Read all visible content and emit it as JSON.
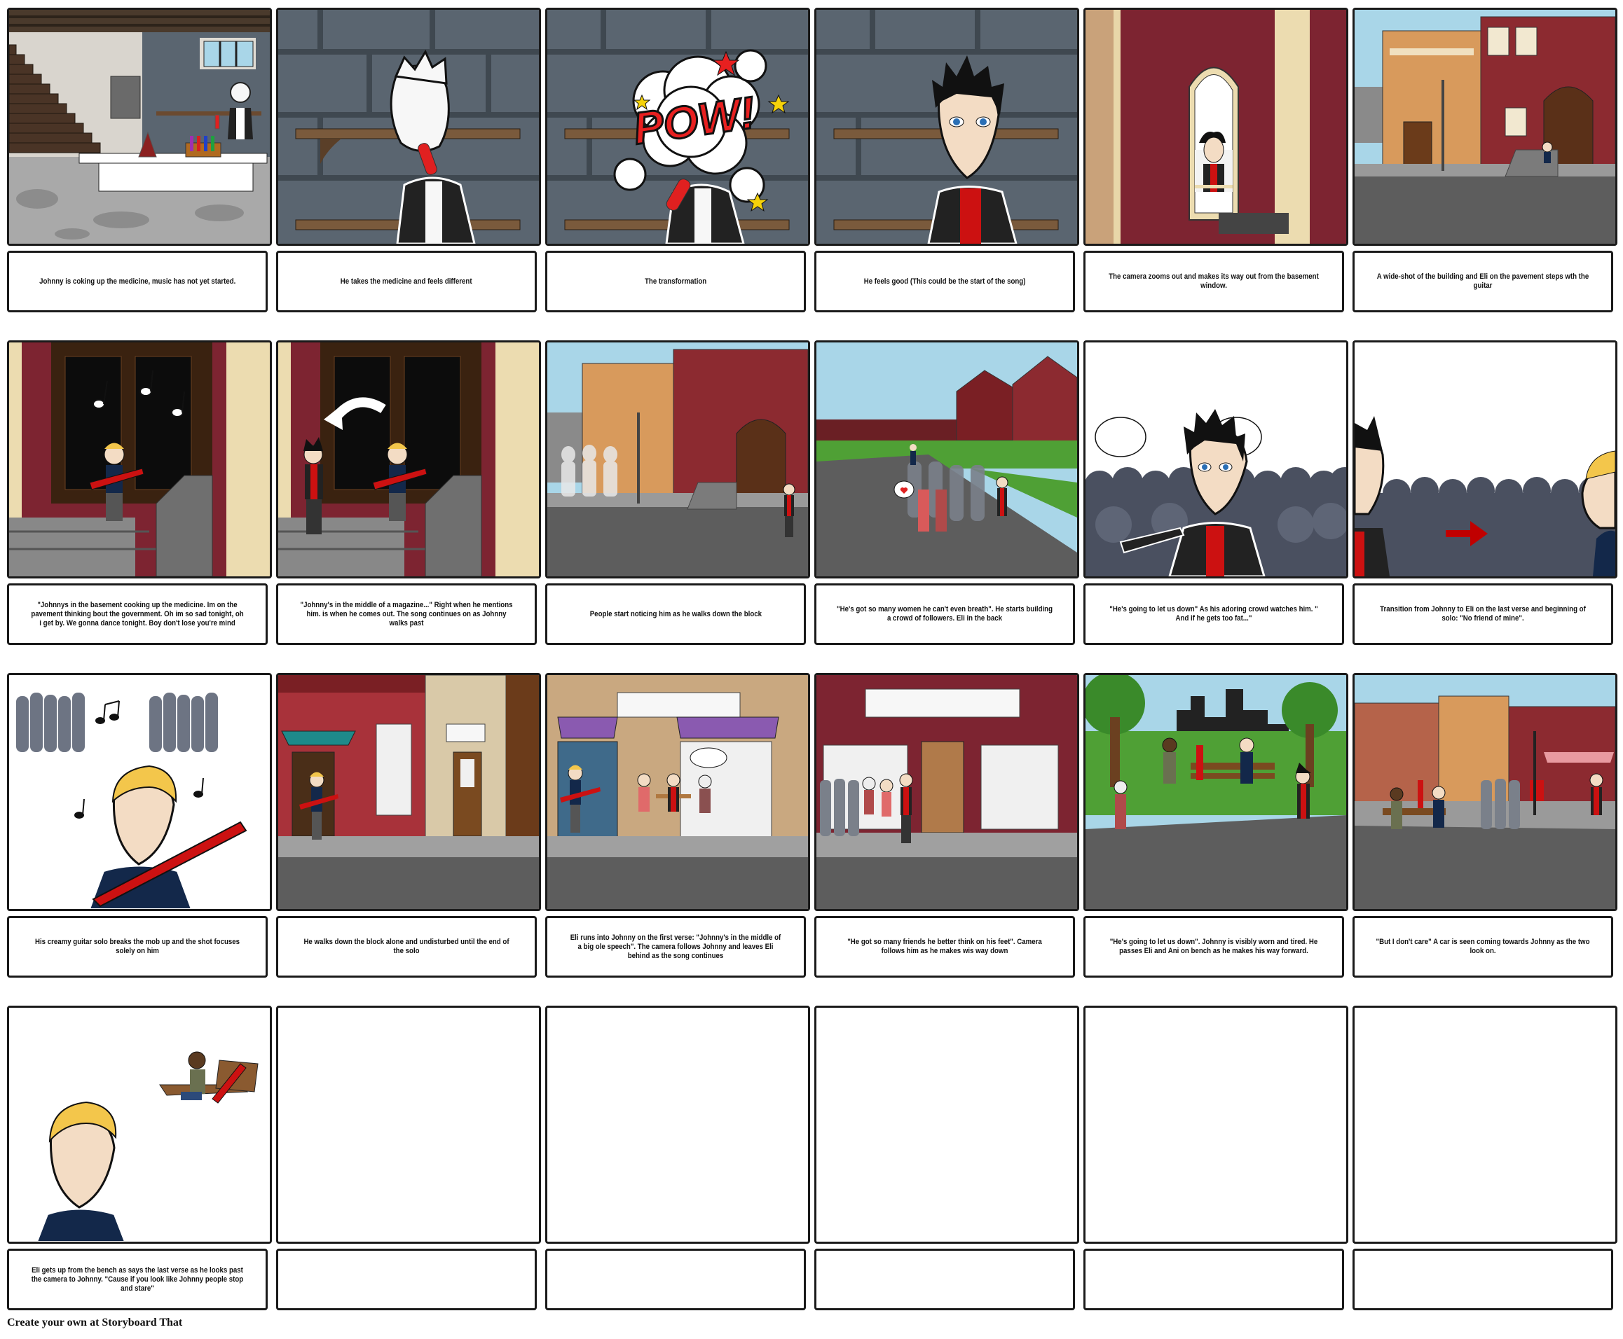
{
  "storyboard": {
    "panels": [
      {
        "scene": "basement-lab",
        "caption": "Johnny is coking up the medicine, music has not yet started."
      },
      {
        "scene": "johnny-drinks",
        "caption": "He takes the medicine and feels different"
      },
      {
        "scene": "pow-transformation",
        "caption": "The transformation",
        "effect_text": "POW!"
      },
      {
        "scene": "johnny-transformed",
        "caption": "He feels good (This could be the start of the song)"
      },
      {
        "scene": "basement-window",
        "caption": "The camera zooms out and makes its way out from the basement window."
      },
      {
        "scene": "building-wide",
        "caption": "A wide-shot of the building and Eli on the pavement steps wth the guitar"
      },
      {
        "scene": "eli-steps-music",
        "caption": "\"Johnnys in the basement cooking up the medicine. Im on the pavement thinking bout the government. Oh im so sad tonight, oh i get by. We gonna dance tonight. Boy don't lose you're mind"
      },
      {
        "scene": "johnny-comes-out",
        "caption": "\"Johnny's in the middle of a magazine...\" Right when he mentions him. is when he comes out. The song continues on as Johnny walks past"
      },
      {
        "scene": "street-noticing",
        "caption": "People start noticing him as he walks down the block"
      },
      {
        "scene": "crowd-followers",
        "caption": "\"He's got so many women he can't even breath\". He starts building a crowd of followers. Eli in the back"
      },
      {
        "scene": "johnny-crowd",
        "caption": "\"He's going to let us down\" As his adoring crowd watches him. \" And if he gets too fat...\""
      },
      {
        "scene": "transition-eli",
        "caption": "Transition from Johnny to Eli on the last verse and beginning of solo: \"No friend of mine\"."
      },
      {
        "scene": "eli-solo",
        "caption": "His creamy guitar solo breaks the mob up and the shot focuses solely on him"
      },
      {
        "scene": "street-alone",
        "caption": "He walks down the block alone and undisturbed until the end of the solo"
      },
      {
        "scene": "cafe-meet",
        "caption": "Eli runs into Johnny on the first verse: \"Johnny's in the middle of a big ole speech\". The camera follows Johnny and leaves Eli behind as the song continues"
      },
      {
        "scene": "shopfront-friends",
        "caption": "\"He got so many friends he better think on his feet\". Camera follows him as he makes wis way down"
      },
      {
        "scene": "park-bench",
        "caption": "\"He's going to let us down\". Johnny is visibly worn and tired. He passes Eli and Ani on bench as he makes his way forward."
      },
      {
        "scene": "town-street-car",
        "caption": "\"But I don't care\" A car is seen coming towards Johnny as the two look on."
      },
      {
        "scene": "eli-closeup-bench",
        "caption": "Eli gets up from the bench as says the last verse as he looks past the camera to Johnny. \"Cause if you look like Johnny people stop and stare\""
      },
      {
        "scene": "empty",
        "caption": ""
      },
      {
        "scene": "empty",
        "caption": ""
      },
      {
        "scene": "empty",
        "caption": ""
      },
      {
        "scene": "empty",
        "caption": ""
      },
      {
        "scene": "empty",
        "caption": ""
      }
    ]
  },
  "colors": {
    "panel_border": "#1a1a1a",
    "stone_wall": "#5a6570",
    "brick_red": "#7d2431",
    "sky": "#a9d6e8",
    "jacket_red": "#cc1111",
    "eli_blue": "#13284a"
  },
  "footer": {
    "credit": "Create your own at Storyboard That"
  }
}
